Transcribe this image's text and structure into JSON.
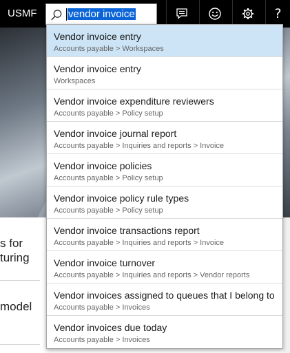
{
  "topbar": {
    "company": "USMF",
    "search": {
      "value": "vendor invoice",
      "icon": "search-icon"
    },
    "icons": [
      "message-icon",
      "smiley-icon",
      "gear-icon",
      "help-icon"
    ],
    "help_label": "?"
  },
  "background": {
    "tile_1_line_1": "s for",
    "tile_1_line_2": "turing",
    "tile_2": "model"
  },
  "results": [
    {
      "title": "Vendor invoice entry",
      "path": "Accounts payable > Workspaces",
      "selected": true
    },
    {
      "title": "Vendor invoice entry",
      "path": "Workspaces"
    },
    {
      "title": "Vendor invoice expenditure reviewers",
      "path": "Accounts payable > Policy setup"
    },
    {
      "title": "Vendor invoice journal report",
      "path": "Accounts payable > Inquiries and reports > Invoice"
    },
    {
      "title": "Vendor invoice policies",
      "path": "Accounts payable > Policy setup"
    },
    {
      "title": "Vendor invoice policy rule types",
      "path": "Accounts payable > Policy setup"
    },
    {
      "title": "Vendor invoice transactions report",
      "path": "Accounts payable > Inquiries and reports > Invoice"
    },
    {
      "title": "Vendor invoice turnover",
      "path": "Accounts payable > Inquiries and reports > Vendor reports"
    },
    {
      "title": "Vendor invoices assigned to queues that I belong to",
      "path": "Accounts payable > Invoices"
    },
    {
      "title": "Vendor invoices due today",
      "path": "Accounts payable > Invoices"
    }
  ],
  "colors": {
    "topbar": "#000000",
    "selection_highlight": "#0a64d8",
    "selected_row": "#cce4f6"
  }
}
